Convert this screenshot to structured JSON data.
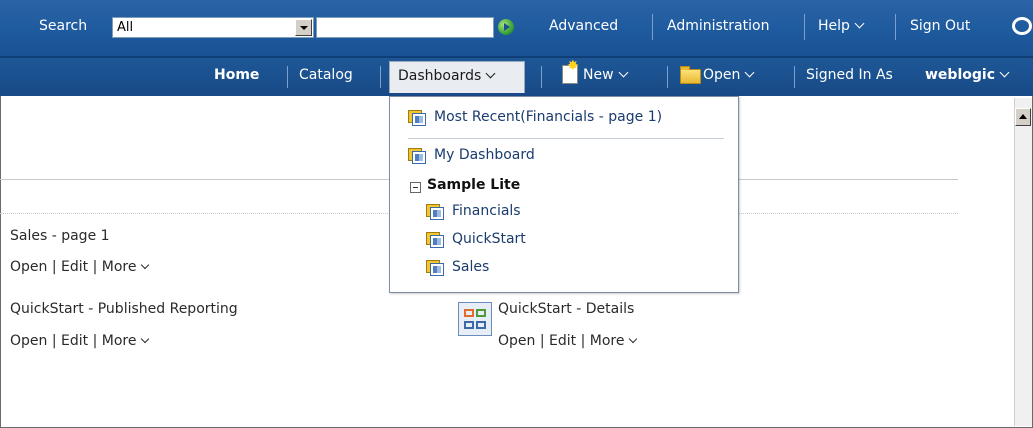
{
  "header": {
    "search_label": "Search",
    "scope_value": "All",
    "search_value": "",
    "links": {
      "advanced": "Advanced",
      "administration": "Administration",
      "help": "Help",
      "sign_out": "Sign Out"
    }
  },
  "nav": {
    "home": "Home",
    "catalog": "Catalog",
    "dashboards": "Dashboards",
    "new": "New",
    "open": "Open",
    "signed_in_as": "Signed In As",
    "user": "weblogic"
  },
  "dashboards_menu": {
    "most_recent": "Most Recent(Financials - page 1)",
    "my_dashboard": "My Dashboard",
    "group": "Sample Lite",
    "items": [
      "Financials",
      "QuickStart",
      "Sales"
    ]
  },
  "content": {
    "items": [
      {
        "title": "Sales - page 1",
        "open": "Open",
        "edit": "Edit",
        "more": "More"
      },
      {
        "title": "QuickStart - Published Reporting",
        "open": "Open",
        "edit": "Edit",
        "more": "More"
      },
      {
        "title": "QuickStart - Details",
        "open": "Open",
        "edit": "Edit",
        "more": "More"
      }
    ]
  },
  "colors": {
    "header_bg": "#1e5a9e",
    "nav_bg": "#174a86",
    "menu_link": "#1a3c6e"
  }
}
